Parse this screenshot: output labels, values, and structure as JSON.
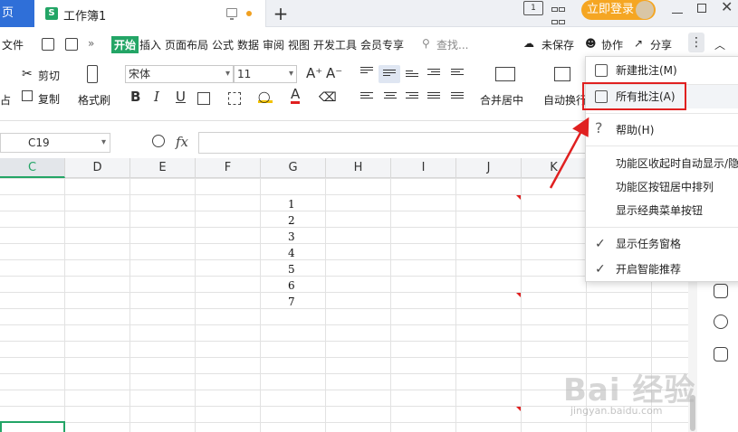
{
  "titlebar": {
    "home_tab": "页",
    "doc_tab": "工作簿1",
    "doc_badge": "S",
    "new_tab": "+",
    "box_label": "1",
    "login": "立即登录",
    "close": "✕"
  },
  "menu": {
    "file": "文件",
    "more": "»",
    "tabs": [
      "开始",
      "插入",
      "页面布局",
      "公式",
      "数据",
      "审阅",
      "视图",
      "开发工具",
      "会员专享"
    ],
    "search": "查找...",
    "unsaved": "未保存",
    "collab": "协作",
    "share": "分享",
    "dots": "⋮",
    "collapse": "︿"
  },
  "ribbon": {
    "cut": "剪切",
    "copy": "复制",
    "format_painter": "格式刷",
    "font": "宋体",
    "font_size": "11",
    "bold": "B",
    "italic": "I",
    "underline": "U",
    "font_grow": "A⁺",
    "font_shrink": "A⁻",
    "font_color": "A",
    "merge_center": "合并居中",
    "wrap": "自动换行",
    "paste_left": "占"
  },
  "formula_bar": {
    "cell_ref": "C19",
    "fx": "fx",
    "formula": ""
  },
  "sheet": {
    "columns": [
      "C",
      "D",
      "E",
      "F",
      "G",
      "H",
      "I",
      "J",
      "K"
    ],
    "active_column": "C",
    "g_values": [
      "1",
      "2",
      "3",
      "4",
      "5",
      "6",
      "7"
    ]
  },
  "dropdown": {
    "items": [
      {
        "label": "新建批注(M)",
        "icon": "new-comment-icon"
      },
      {
        "label": "所有批注(A)",
        "icon": "all-comments-icon"
      },
      {
        "label": "帮助(H)",
        "icon": "help-icon"
      },
      {
        "label": "功能区收起时自动显示/隐",
        "icon": ""
      },
      {
        "label": "功能区按钮居中排列",
        "icon": ""
      },
      {
        "label": "显示经典菜单按钮",
        "icon": ""
      },
      {
        "label": "显示任务窗格",
        "icon": "check-icon"
      },
      {
        "label": "开启智能推荐",
        "icon": "check-icon"
      }
    ],
    "highlight_color": "#e02020"
  },
  "watermark": {
    "text": "Bai 经验",
    "url": "jingyan.baidu.com"
  },
  "colors": {
    "accent_green": "#23a566",
    "home_blue": "#2f6fd8",
    "login_orange": "#f5a623",
    "annotation_red": "#e02020"
  }
}
